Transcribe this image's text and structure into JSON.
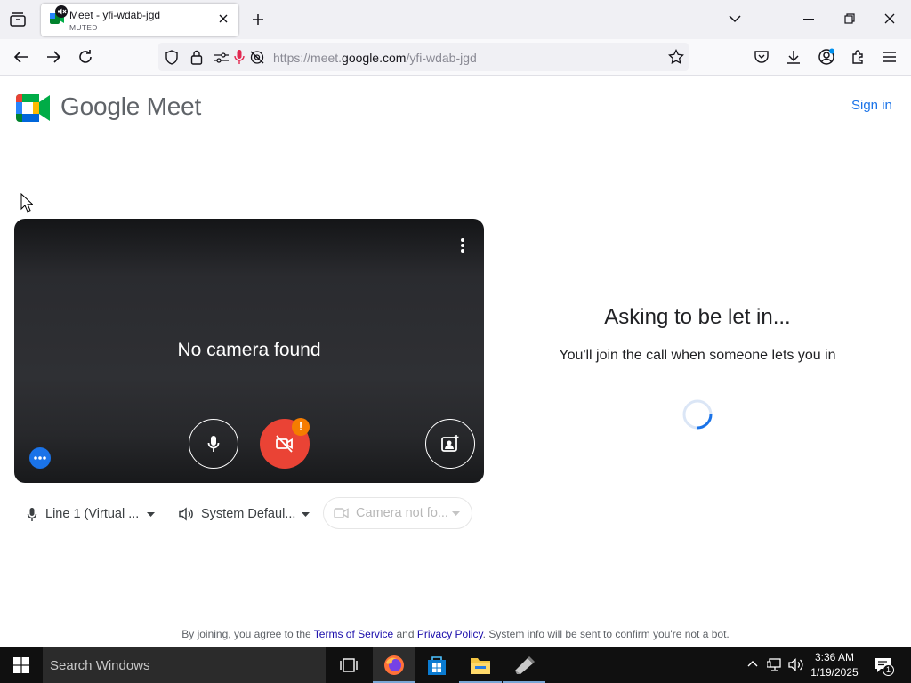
{
  "browser": {
    "tab": {
      "title": "Meet - yfi-wdab-jgd",
      "status": "MUTED"
    },
    "url_prefix": "https://meet.",
    "url_domain": "google.com",
    "url_path": "/yfi-wdab-jgd"
  },
  "page": {
    "logo_text": "Google Meet",
    "sign_in": "Sign in",
    "preview": {
      "message": "No camera found",
      "badge": "!"
    },
    "asking_title": "Asking to be let in...",
    "asking_subtitle": "You'll join the call when someone lets you in",
    "devices": {
      "microphone": "Line 1 (Virtual ...",
      "speaker": "System Defaul...",
      "camera": "Camera not fo..."
    },
    "terms": {
      "prefix": "By joining, you agree to the ",
      "tos": "Terms of Service",
      "and": " and ",
      "privacy": "Privacy Policy",
      "suffix": ". System info will be sent to confirm you're not a bot."
    }
  },
  "taskbar": {
    "search_placeholder": "Search Windows",
    "time": "3:36 AM",
    "date": "1/19/2025",
    "notification_count": "1"
  },
  "colors": {
    "accent_blue": "#1a73e8",
    "cam_off_red": "#ea4335",
    "badge_orange": "#f57c00"
  }
}
